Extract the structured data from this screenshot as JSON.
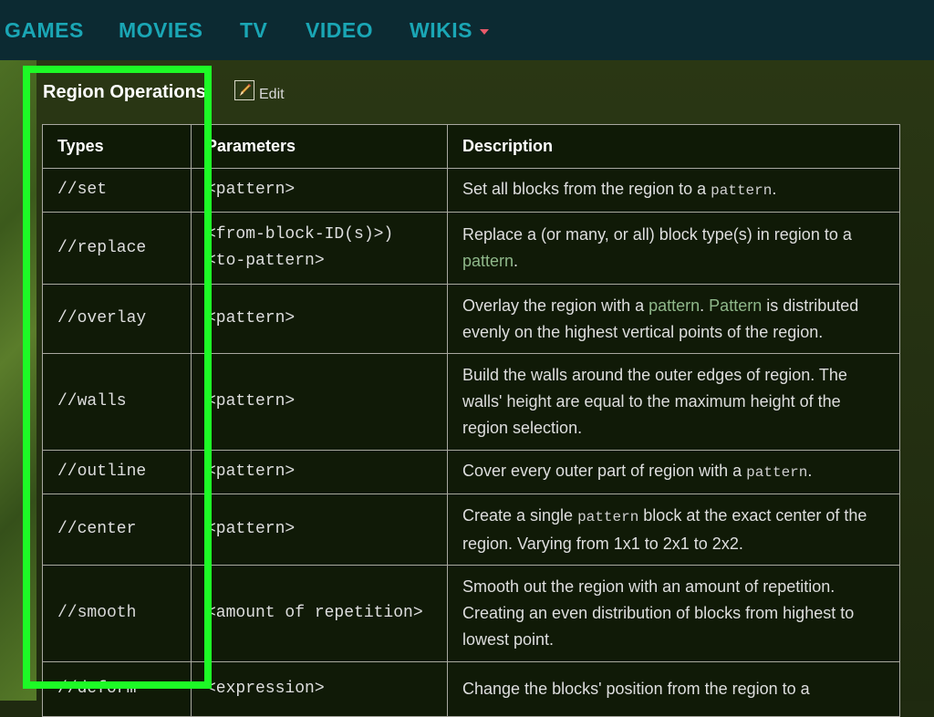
{
  "nav": {
    "items": [
      "GAMES",
      "MOVIES",
      "TV",
      "VIDEO",
      "WIKIS"
    ]
  },
  "section": {
    "title": "Region Operations",
    "edit_label": "Edit"
  },
  "table": {
    "headers": [
      "Types",
      "Parameters",
      "Description"
    ],
    "rows": [
      {
        "type": "//set",
        "param_lines": [
          "<pattern>"
        ],
        "desc": [
          {
            "t": "Set all blocks from the region to a "
          },
          {
            "t": "pattern",
            "k": "code"
          },
          {
            "t": "."
          }
        ]
      },
      {
        "type": "//replace",
        "param_lines": [
          "<from-block-ID(s)>)",
          "<to-pattern>"
        ],
        "desc": [
          {
            "t": "Replace a (or many, or all) block type(s) in region to a "
          },
          {
            "t": "pattern",
            "k": "link"
          },
          {
            "t": "."
          }
        ]
      },
      {
        "type": "//overlay",
        "param_lines": [
          "<pattern>"
        ],
        "desc": [
          {
            "t": "Overlay the region with a "
          },
          {
            "t": "pattern",
            "k": "link"
          },
          {
            "t": ". "
          },
          {
            "t": "Pattern",
            "k": "link"
          },
          {
            "t": " is distributed evenly on the highest vertical points of the region."
          }
        ]
      },
      {
        "type": "//walls",
        "param_lines": [
          "<pattern>"
        ],
        "desc": [
          {
            "t": "Build the walls around the outer edges of region. The walls' height are equal to the maximum height of the region selection."
          }
        ]
      },
      {
        "type": "//outline",
        "param_lines": [
          "<pattern>"
        ],
        "desc": [
          {
            "t": "Cover every outer part of region with a "
          },
          {
            "t": "pattern",
            "k": "code"
          },
          {
            "t": "."
          }
        ]
      },
      {
        "type": "//center",
        "param_lines": [
          "<pattern>"
        ],
        "desc": [
          {
            "t": "Create a single "
          },
          {
            "t": "pattern",
            "k": "code"
          },
          {
            "t": " block at the exact center of the region. Varying from 1x1 to 2x1 to 2x2."
          }
        ]
      },
      {
        "type": "//smooth",
        "plain": true,
        "param_lines": [
          "<amount of repetition>"
        ],
        "desc": [
          {
            "t": "Smooth out the region with an amount of repetition. Creating an even distribution of blocks from highest to lowest point."
          }
        ]
      },
      {
        "type": "//deform",
        "param_lines": [
          "<expression>"
        ],
        "desc": [
          {
            "t": "Change the blocks' position from the region to a"
          }
        ]
      }
    ]
  },
  "colors": {
    "nav_bg": "#0c2a32",
    "nav_text": "#1aa6b5",
    "command_red": "#d63b2e",
    "highlight_green": "#1dfa26"
  }
}
